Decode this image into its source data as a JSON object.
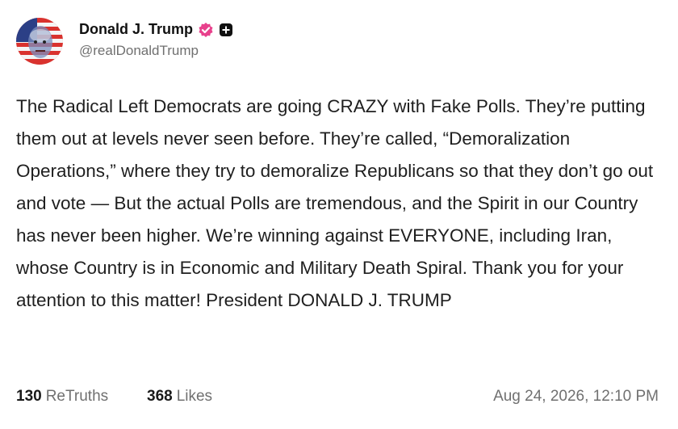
{
  "author": {
    "display_name": "Donald J. Trump",
    "handle": "@realDonaldTrump",
    "verified_icon": "verified-badge-icon",
    "verified_color": "#e8418c",
    "extra_icon": "plus-square-icon"
  },
  "post": {
    "text": "The Radical Left Democrats are going CRAZY with Fake Polls. They’re putting them out at levels never seen before. They’re called, “Demoralization Operations,” where they try to demoralize Republicans so that they don’t go out and vote — But the actual Polls are tremendous, and the Spirit in our Country has never been higher. We’re winning against EVERYONE, including Iran, whose Country is in Economic and Military Death Spiral. Thank you for your attention to this matter! President DONALD J. TRUMP"
  },
  "stats": {
    "retruths_count": "130",
    "retruths_label": "ReTruths",
    "likes_count": "368",
    "likes_label": "Likes"
  },
  "timestamp": "Aug 24, 2026, 12:10 PM"
}
